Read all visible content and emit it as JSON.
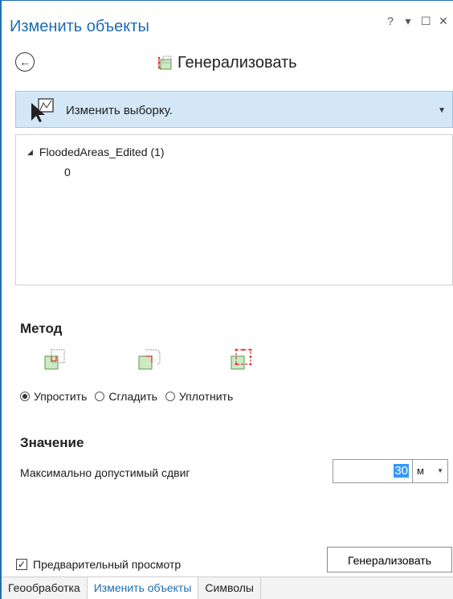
{
  "pane": {
    "title": "Изменить объекты",
    "controls": [
      "?",
      "▾",
      "☐",
      "✕"
    ]
  },
  "header": {
    "back_icon": "back-arrow-icon",
    "tool_title": "Генерализовать",
    "tool_icon": "generalize-icon"
  },
  "selection": {
    "label": "Изменить выборку.",
    "icon": "select-features-icon"
  },
  "tree": {
    "layer": "FloodedAreas_Edited (1)",
    "feature": "0"
  },
  "method": {
    "heading": "Метод",
    "icons": [
      "simplify-icon",
      "smooth-icon",
      "densify-icon"
    ],
    "options": [
      "Упростить",
      "Сгладить",
      "Уплотнить"
    ],
    "selected": "Упростить"
  },
  "value": {
    "heading": "Значение",
    "field_label": "Максимально допустимый сдвиг",
    "input_value": "30",
    "unit": "м"
  },
  "footer": {
    "preview_label": "Предварительный просмотр",
    "preview_checked": true,
    "run_button": "Генерализовать"
  },
  "tabs": [
    {
      "label": "Геообработка",
      "active": false
    },
    {
      "label": "Изменить объекты",
      "active": true
    },
    {
      "label": "Символы",
      "active": false
    }
  ],
  "colors": {
    "accent": "#1d6cb0",
    "selection_bar": "#d4e7f7",
    "input_highlight": "#3399ff"
  }
}
